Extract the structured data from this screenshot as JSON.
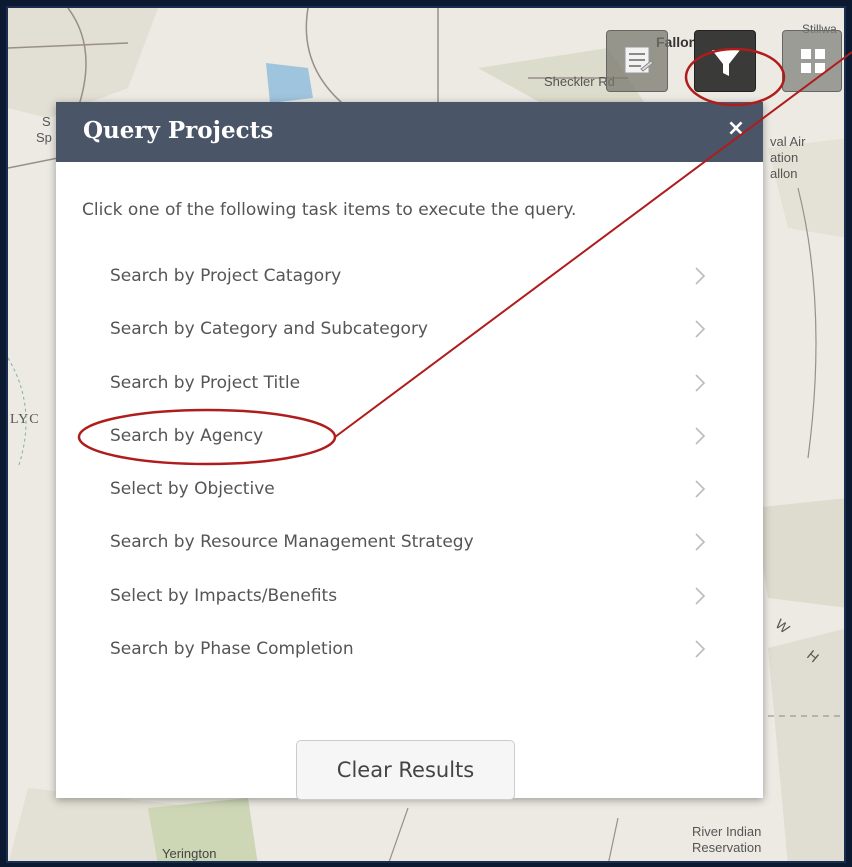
{
  "map": {
    "labels": {
      "fallon": "Fallon",
      "stillwater": "Stillwa",
      "sheckler": "Sheckler Rd",
      "naval_air_1": "val Air",
      "naval_air_2": "ation",
      "naval_air_3": "allon",
      "left_s": "S",
      "left_sp": "Sp",
      "lyon": "LYC",
      "wh_1": "W",
      "wh_2": "H",
      "river_indian_1": "River Indian",
      "river_indian_2": "Reservation",
      "yerington": "Yerington"
    },
    "colors": {
      "base": "#eceae3",
      "road": "#9a8f8a",
      "water": "#9fc4de",
      "green": "#cdd7b5"
    }
  },
  "toolbar": {
    "attribute_table_icon": "table-icon",
    "filter_icon": "filter-icon",
    "grid_icon": "grid-icon"
  },
  "panel": {
    "title": "Query Projects",
    "close_label": "×",
    "instructions": "Click one of the following task items to execute the query.",
    "tasks": [
      {
        "label": "Search by Project Catagory"
      },
      {
        "label": "Search by Category and Subcategory"
      },
      {
        "label": "Search by Project Title"
      },
      {
        "label": "Search by Agency"
      },
      {
        "label": "Select by Objective"
      },
      {
        "label": "Search by Resource Management Strategy"
      },
      {
        "label": "Select by Impacts/Benefits"
      },
      {
        "label": "Search by Phase Completion"
      }
    ],
    "clear_button": "Clear Results",
    "header_color": "#4a5568"
  },
  "annotation": {
    "color": "#b01c1c"
  }
}
